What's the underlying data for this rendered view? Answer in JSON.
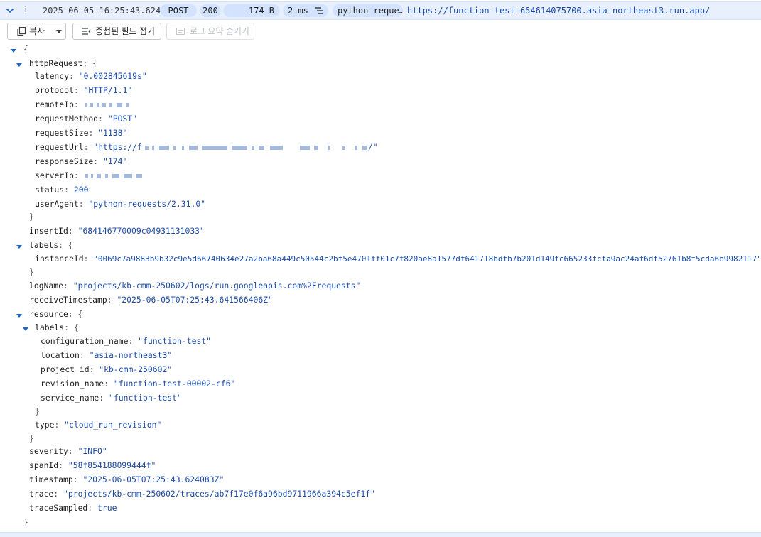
{
  "header": {
    "severity": "i",
    "timestamp": "2025-06-05 16:25:43.624",
    "method": "POST",
    "status": "200",
    "size": "174 B",
    "latency": "2 ms",
    "user_agent": "python-reque…",
    "url": "https://function-test-654614075700.asia-northeast3.run.app/"
  },
  "toolbar": {
    "copy_label": "복사",
    "collapse_label": "중첩된 필드 접기",
    "hide_summary_label": "로그 요약 숨기기"
  },
  "json": {
    "open_brace": "{",
    "httpRequest_key": "httpRequest",
    "latency_key": "latency",
    "latency_val": "\"0.002845619s\"",
    "protocol_key": "protocol",
    "protocol_val": "\"HTTP/1.1\"",
    "remoteIp_key": "remoteIp",
    "requestMethod_key": "requestMethod",
    "requestMethod_val": "\"POST\"",
    "requestSize_key": "requestSize",
    "requestSize_val": "\"1138\"",
    "requestUrl_key": "requestUrl",
    "requestUrl_val_start": "\"https://f",
    "requestUrl_val_end": "/\"",
    "responseSize_key": "responseSize",
    "responseSize_val": "\"174\"",
    "serverIp_key": "serverIp",
    "status_key": "status",
    "status_val": "200",
    "userAgent_key": "userAgent",
    "userAgent_val": "\"python-requests/2.31.0\"",
    "insertId_key": "insertId",
    "insertId_val": "\"684146770009c04931131033\"",
    "labels_key": "labels",
    "instanceId_key": "instanceId",
    "instanceId_val": "\"0069c7a9883b9b32c9e5d66740634e27a2ba68a449c50544c2bf5e4701ff01c7f820ae8a1577df641718bdfb7b201d149fc665233fcfa9ac24af6df52761b8f5cda6b9982117\"",
    "logName_key": "logName",
    "logName_val": "\"projects/kb-cmm-250602/logs/run.googleapis.com%2Frequests\"",
    "receiveTimestamp_key": "receiveTimestamp",
    "receiveTimestamp_val": "\"2025-06-05T07:25:43.641566406Z\"",
    "resource_key": "resource",
    "res_labels_key": "labels",
    "configuration_name_key": "configuration_name",
    "configuration_name_val": "\"function-test\"",
    "location_key": "location",
    "location_val": "\"asia-northeast3\"",
    "project_id_key": "project_id",
    "project_id_val": "\"kb-cmm-250602\"",
    "revision_name_key": "revision_name",
    "revision_name_val": "\"function-test-00002-cf6\"",
    "service_name_key": "service_name",
    "service_name_val": "\"function-test\"",
    "type_key": "type",
    "type_val": "\"cloud_run_revision\"",
    "severity_key": "severity",
    "severity_val": "\"INFO\"",
    "spanId_key": "spanId",
    "spanId_val": "\"58f854188099444f\"",
    "timestamp_key": "timestamp",
    "timestamp_val": "\"2025-06-05T07:25:43.624083Z\"",
    "trace_key": "trace",
    "trace_val": "\"projects/kb-cmm-250602/traces/ab7f17e0f6a96bd9711966a394c5ef1f\"",
    "traceSampled_key": "traceSampled",
    "traceSampled_val": "true",
    "close_brace": "}"
  },
  "colors": {
    "header_bg": "#e8f0fe",
    "chip_bg": "#d3e3fd",
    "string_value": "#1a4aa8",
    "twisty": "#1967d2"
  }
}
